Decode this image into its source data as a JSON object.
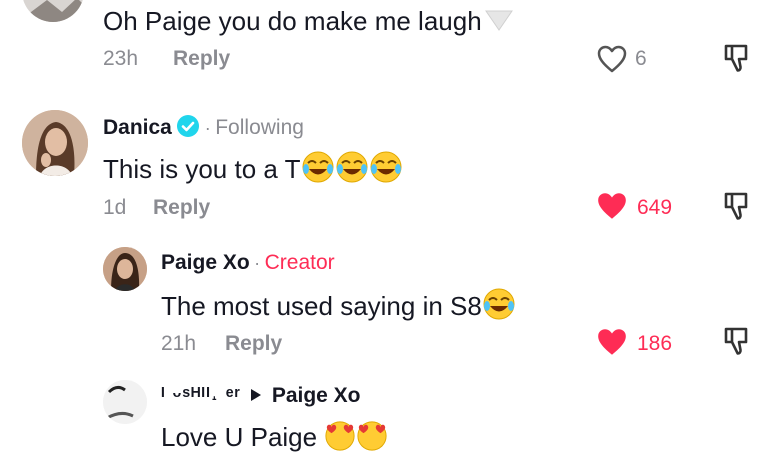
{
  "comments": [
    {
      "text": "Oh Paige you do make me laugh",
      "emoji": "white-heart",
      "time": "23h",
      "reply_label": "Reply",
      "likes": "6",
      "liked": false
    },
    {
      "author": "Danica",
      "verified": true,
      "separator": "·",
      "relation": "Following",
      "text": "This is you to a T",
      "emojis": [
        "face-with-tears-of-joy",
        "face-with-tears-of-joy",
        "face-with-tears-of-joy"
      ],
      "time": "1d",
      "reply_label": "Reply",
      "likes": "649",
      "liked": true
    },
    {
      "author": "Paige Xo",
      "separator": "·",
      "role": "Creator",
      "text": "The most used saying in S8",
      "emojis": [
        "face-with-tears-of-joy"
      ],
      "time": "21h",
      "reply_label": "Reply",
      "likes": "186",
      "liked": true
    },
    {
      "author_partial": "ᴵ ᵕˢᴴᴵᴵ˔ ᵉʳ",
      "reply_to": "Paige Xo",
      "text": "Love U Paige",
      "emojis": [
        "smiling-face-with-hearts",
        "smiling-face-with-hearts"
      ]
    }
  ],
  "colors": {
    "accent": "#fe2c55",
    "muted": "#8a8b91",
    "text": "#161823",
    "verified": "#20d5ec"
  }
}
